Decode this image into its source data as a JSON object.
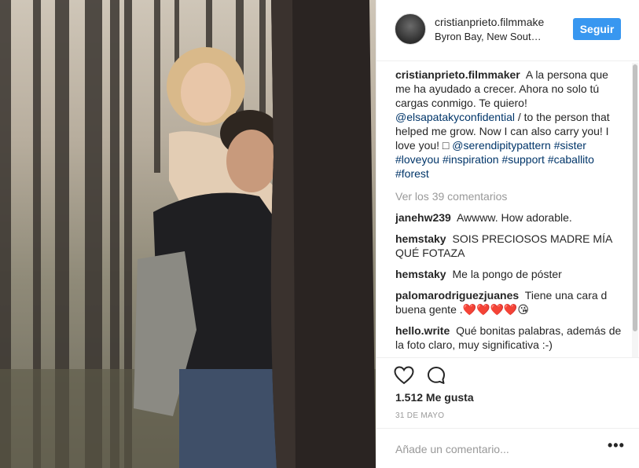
{
  "post": {
    "username": "cristianprieto.filmmake",
    "location": "Byron Bay, New Sout…",
    "follow_label": "Seguir"
  },
  "caption": {
    "username": "cristianprieto.filmmaker",
    "text_1": "A la persona que me ha ayudado a crecer. Ahora no solo tú cargas conmigo. Te quiero!",
    "mention_1": "@elsapatakyconfidential",
    "text_2": "/ to the person that helped me grow. Now I can also carry you! I love you! □",
    "mention_2": "@serendipitypattern",
    "hashtags": [
      "#sister",
      "#loveyou",
      "#inspiration",
      "#support",
      "#caballito",
      "#forest"
    ]
  },
  "view_all_comments": "Ver los 39 comentarios",
  "comments": [
    {
      "username": "janehw239",
      "text": "Awwww. How adorable."
    },
    {
      "username": "hemstaky",
      "text": "SOIS PRECIOSOS MADRE MÍA QUÉ FOTAZA"
    },
    {
      "username": "hemstaky",
      "text": "Me la pongo de póster"
    },
    {
      "username": "palomarodriguezjuanes",
      "text": "Tiene una cara d buena gente .❤️❤️❤️❤️😘"
    },
    {
      "username": "hello.write",
      "text": "Qué bonitas palabras, además de la foto claro, muy significativa :-)"
    }
  ],
  "likes_text": "1.512 Me gusta",
  "date_text": "31 DE MAYO",
  "add_comment_placeholder": "Añade un comentario...",
  "more_options_symbol": "•••",
  "icons": {
    "like": "heart-outline-icon",
    "comment": "speech-bubble-icon",
    "more": "ellipsis-icon"
  },
  "colors": {
    "follow_button": "#3897f0",
    "link": "#003569",
    "muted": "#999999"
  }
}
